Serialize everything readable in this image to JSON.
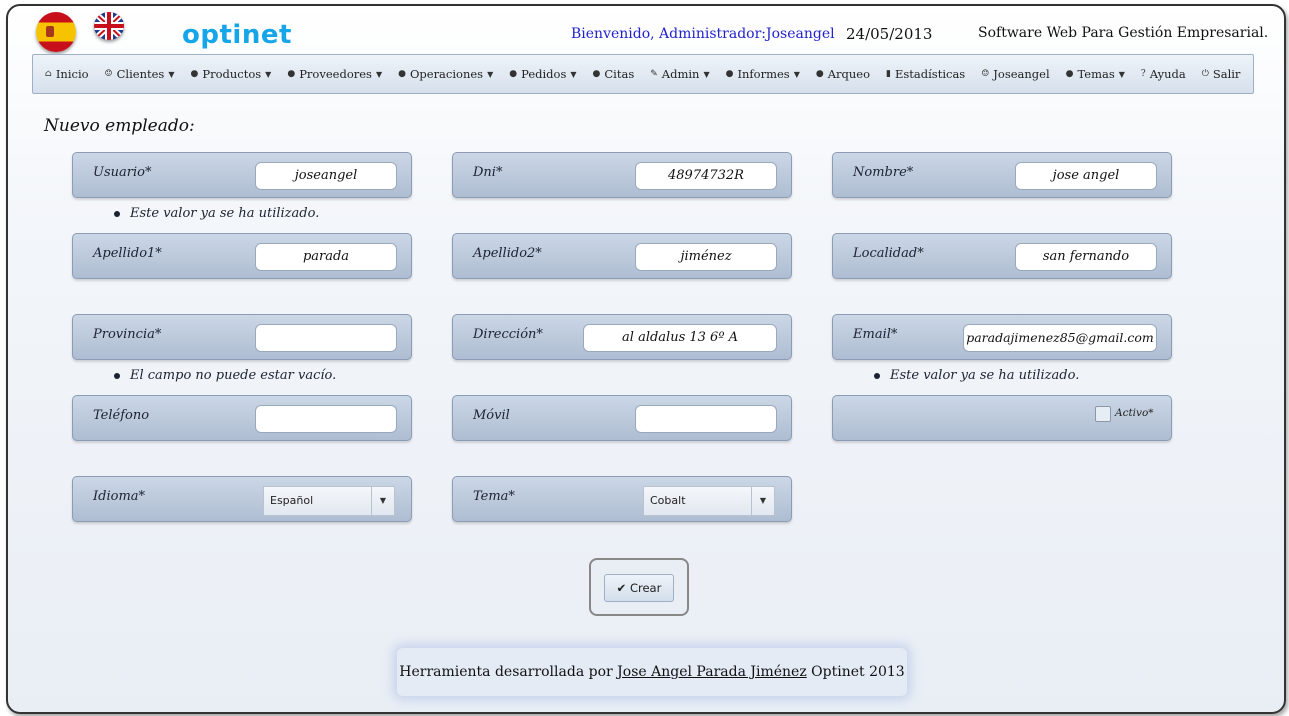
{
  "header": {
    "logo": "optinet",
    "welcome": "Bienvenido, Administrador:Joseangel",
    "date": "24/05/2013",
    "tagline": "Software Web Para Gestión Empresarial."
  },
  "nav": {
    "inicio": "Inicio",
    "clientes": "Clientes",
    "productos": "Productos",
    "proveedores": "Proveedores",
    "operaciones": "Operaciones",
    "pedidos": "Pedidos",
    "citas": "Citas",
    "admin": "Admin",
    "informes": "Informes",
    "arqueo": "Arqueo",
    "estadisticas": "Estadísticas",
    "user": "Joseangel",
    "temas": "Temas",
    "ayuda": "Ayuda",
    "salir": "Salir"
  },
  "page_title": "Nuevo empleado:",
  "fields": {
    "usuario": {
      "label": "Usuario*",
      "value": "joseangel"
    },
    "dni": {
      "label": "Dni*",
      "value": "48974732R"
    },
    "nombre": {
      "label": "Nombre*",
      "value": "jose angel"
    },
    "apellido1": {
      "label": "Apellido1*",
      "value": "parada"
    },
    "apellido2": {
      "label": "Apellido2*",
      "value": "jiménez"
    },
    "localidad": {
      "label": "Localidad*",
      "value": "san fernando"
    },
    "provincia": {
      "label": "Provincia*",
      "value": ""
    },
    "direccion": {
      "label": "Dirección*",
      "value": "al aldalus 13 6º A"
    },
    "email": {
      "label": "Email*",
      "value": "paradajimenez85@gmail.com"
    },
    "telefono": {
      "label": "Teléfono",
      "value": ""
    },
    "movil": {
      "label": "Móvil",
      "value": ""
    },
    "activo": {
      "label": "Activo*",
      "checked": false
    },
    "idioma": {
      "label": "Idioma*",
      "selected": "Español"
    },
    "tema": {
      "label": "Tema*",
      "selected": "Cobalt"
    }
  },
  "errors": {
    "usuario": "Este valor ya se ha utilizado.",
    "provincia": "El campo no puede estar vacío.",
    "email": "Este valor ya se ha utilizado."
  },
  "buttons": {
    "crear": "Crear"
  },
  "footer": {
    "prefix": "Herramienta desarrollada por",
    "author": "Jose Angel Parada Jiménez",
    "suffix": "Optinet 2013"
  },
  "colors": {
    "logo": "#16a6e8",
    "welcome": "#2222cc",
    "panel": "#b9c7da"
  }
}
